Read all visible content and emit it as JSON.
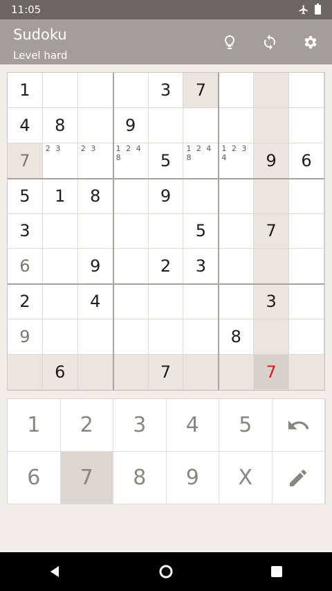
{
  "status_bar": {
    "time": "11:05",
    "icons": [
      "airplane-icon",
      "battery-icon"
    ]
  },
  "app_bar": {
    "title": "Sudoku",
    "subtitle": "Level hard",
    "actions": [
      "lightbulb-icon",
      "refresh-icon",
      "settings-icon"
    ]
  },
  "colors": {
    "status_bar": "#6b6661",
    "app_bar": "#a39e99",
    "background": "#f1ede9",
    "highlight": "#ebe5e0",
    "selected": "#d8d0ca",
    "error": "#d32020"
  },
  "board": {
    "rows": [
      [
        "1",
        "",
        "",
        "",
        "3",
        "7",
        "",
        "",
        ""
      ],
      [
        "4",
        "8",
        "",
        "9",
        "",
        "",
        "",
        "",
        ""
      ],
      [
        "7",
        "",
        "",
        "",
        "5",
        "",
        "",
        "9",
        "6"
      ],
      [
        "5",
        "1",
        "8",
        "",
        "9",
        "",
        "",
        "",
        ""
      ],
      [
        "3",
        "",
        "",
        "",
        "",
        "5",
        "",
        "7",
        ""
      ],
      [
        "6",
        "",
        "9",
        "",
        "2",
        "3",
        "",
        "",
        ""
      ],
      [
        "2",
        "",
        "4",
        "",
        "",
        "",
        "",
        "3",
        ""
      ],
      [
        "9",
        "",
        "",
        "",
        "",
        "",
        "8",
        "",
        ""
      ],
      [
        "",
        "6",
        "",
        "",
        "7",
        "",
        "",
        "7",
        ""
      ]
    ],
    "notes": {
      "2-1": "2 3",
      "2-2": "2 3",
      "2-3": "1 2 4\n8",
      "2-5": "1 2 4\n8",
      "2-6": "1 2 3\n4"
    },
    "selected_cell": "8-7",
    "highlighted_row": 8,
    "highlighted_col": 7,
    "muted_cells": [
      "2-0",
      "5-0",
      "7-0"
    ],
    "error_cells": [
      "8-7"
    ],
    "extra_highlight": [
      "0-5",
      "2-0"
    ]
  },
  "keypad": {
    "keys": [
      "1",
      "2",
      "3",
      "4",
      "5",
      "undo",
      "6",
      "7",
      "8",
      "9",
      "X",
      "pencil"
    ],
    "active_key": "7"
  },
  "nav_bar": {
    "buttons": [
      "back-icon",
      "home-icon",
      "recents-icon"
    ]
  }
}
